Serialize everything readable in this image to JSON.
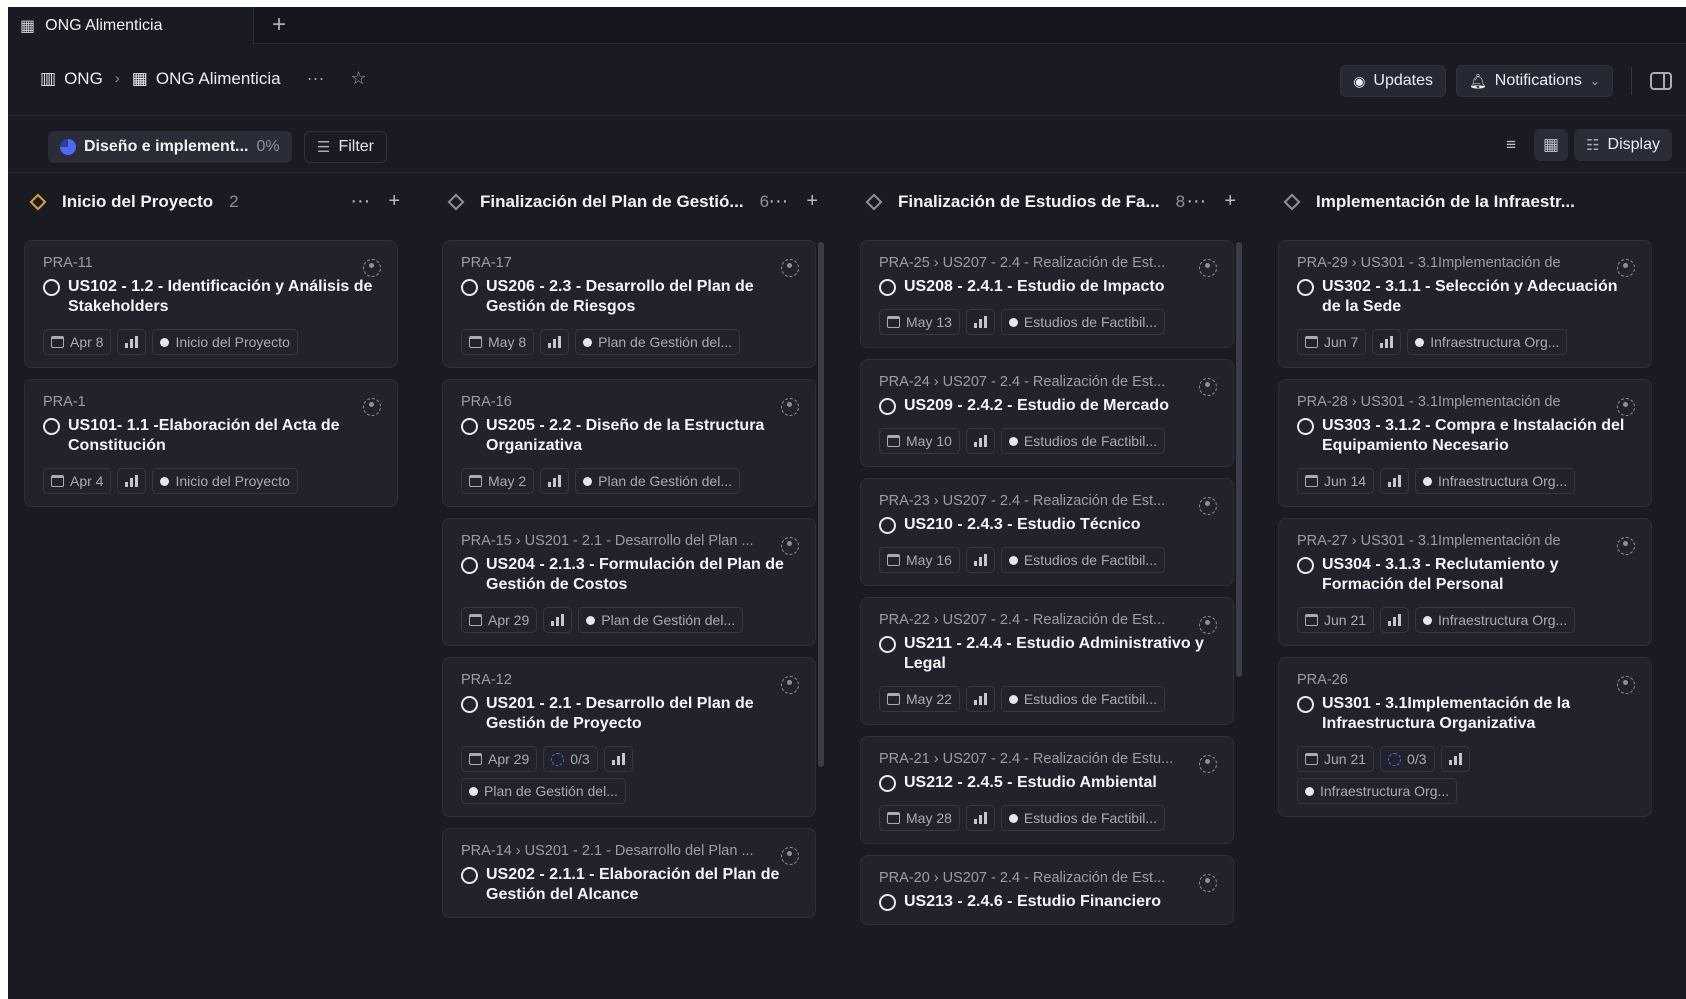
{
  "tabbar": {
    "tab_title": "ONG Alimenticia",
    "new_tab": "+"
  },
  "header": {
    "crumb1": "ONG",
    "crumb2": "ONG Alimenticia",
    "updates_label": "Updates",
    "notifications_label": "Notifications"
  },
  "filters": {
    "cycle_label": "Diseño e implement...",
    "cycle_pct": "0%",
    "filter_label": "Filter",
    "display_label": "Display"
  },
  "columns": [
    {
      "name": "Inicio del Proyecto",
      "count": "2",
      "color": "#d9a531",
      "cards": [
        {
          "id": "PRA-11",
          "title": "US102 - 1.2 - Identificación y Análisis de Stakeholders",
          "date": "Apr 8",
          "progress": "",
          "label": "Inicio del Proyecto"
        },
        {
          "id": "PRA-1",
          "title": "US101- 1.1 -Elaboración del Acta de Constitución",
          "date": "Apr 4",
          "progress": "",
          "label": "Inicio del Proyecto"
        }
      ]
    },
    {
      "name": "Finalización del Plan de Gestió...",
      "count": "6",
      "color": "#8d909c",
      "cards": [
        {
          "id": "PRA-17",
          "title": "US206 - 2.3 - Desarrollo del Plan de Gestión de Riesgos",
          "date": "May 8",
          "progress": "",
          "label": "Plan de Gestión del..."
        },
        {
          "id": "PRA-16",
          "title": "US205 - 2.2 - Diseño de la Estructura Organizativa",
          "date": "May 2",
          "progress": "",
          "label": "Plan de Gestión del..."
        },
        {
          "id": "PRA-15 › US201 - 2.1 - Desarrollo del Plan ...",
          "title": "US204 - 2.1.3 - Formulación del Plan de Gestión de Costos",
          "date": "Apr 29",
          "progress": "",
          "label": "Plan de Gestión del..."
        },
        {
          "id": "PRA-12",
          "title": "US201 - 2.1 - Desarrollo del Plan de Gestión de Proyecto",
          "date": "Apr 29",
          "progress": "0/3",
          "label": "Plan de Gestión del..."
        },
        {
          "id": "PRA-14 › US201 - 2.1 - Desarrollo del Plan ...",
          "title": "US202 - 2.1.1 - Elaboración del Plan de Gestión del Alcance",
          "date": "",
          "progress": "",
          "label": ""
        }
      ]
    },
    {
      "name": "Finalización de Estudios de Fa...",
      "count": "8",
      "color": "#8d909c",
      "cards": [
        {
          "id": "PRA-25 › US207 - 2.4 - Realización de Est...",
          "title": "US208 - 2.4.1 - Estudio de Impacto",
          "date": "May 13",
          "progress": "",
          "label": "Estudios de Factibil..."
        },
        {
          "id": "PRA-24 › US207 - 2.4 - Realización de Est...",
          "title": "US209 - 2.4.2 - Estudio de Mercado",
          "date": "May 10",
          "progress": "",
          "label": "Estudios de Factibil..."
        },
        {
          "id": "PRA-23 › US207 - 2.4 - Realización de Est...",
          "title": "US210 - 2.4.3 - Estudio Técnico",
          "date": "May 16",
          "progress": "",
          "label": "Estudios de Factibil..."
        },
        {
          "id": "PRA-22 › US207 - 2.4 - Realización de Est...",
          "title": "US211 - 2.4.4 - Estudio Administrativo y Legal",
          "date": "May 22",
          "progress": "",
          "label": "Estudios de Factibil..."
        },
        {
          "id": "PRA-21 › US207 - 2.4 - Realización de Estu...",
          "title": "US212 - 2.4.5 - Estudio Ambiental",
          "date": "May 28",
          "progress": "",
          "label": "Estudios de Factibil..."
        },
        {
          "id": "PRA-20 › US207 - 2.4 - Realización de Est...",
          "title": "US213 - 2.4.6 - Estudio Financiero",
          "date": "",
          "progress": "",
          "label": ""
        }
      ]
    },
    {
      "name": "Implementación de la Infraestr...",
      "count": "",
      "color": "#8d909c",
      "cards": [
        {
          "id": "PRA-29 › US301 - 3.1Implementación de",
          "title": "US302 - 3.1.1 - Selección y Adecuación de la Sede",
          "date": "Jun 7",
          "progress": "",
          "label": "Infraestructura Org..."
        },
        {
          "id": "PRA-28 › US301 - 3.1Implementación de",
          "title": "US303 - 3.1.2 - Compra e Instalación del Equipamiento Necesario",
          "date": "Jun 14",
          "progress": "",
          "label": "Infraestructura Org..."
        },
        {
          "id": "PRA-27 › US301 - 3.1Implementación de",
          "title": "US304 - 3.1.3 - Reclutamiento y Formación del Personal",
          "date": "Jun 21",
          "progress": "",
          "label": "Infraestructura Org..."
        },
        {
          "id": "PRA-26",
          "title": "US301 - 3.1Implementación de la Infraestructura Organizativa",
          "date": "Jun 21",
          "progress": "0/3",
          "label": "Infraestructura Org..."
        }
      ]
    }
  ]
}
